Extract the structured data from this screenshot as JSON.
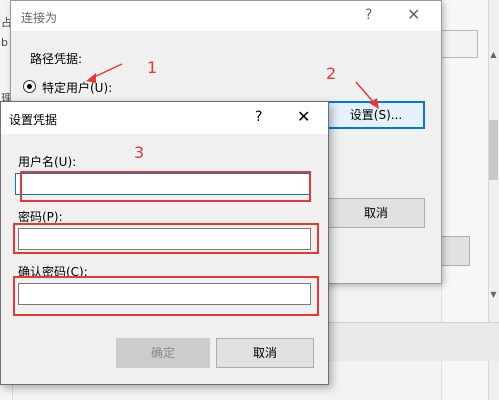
{
  "background": {
    "left_letters": [
      "占",
      "b",
      "理"
    ],
    "cancel_label": "取消"
  },
  "connect_dialog": {
    "title": "连接为",
    "help": "?",
    "close": "✕",
    "path_label": "路径凭据:",
    "radio_label": "特定用户(U):",
    "settings_label": "设置(S)...",
    "cancel_label": "取消"
  },
  "credentials_dialog": {
    "title": "设置凭据",
    "help": "?",
    "close": "✕",
    "username_label": "用户名(U):",
    "username_value": "",
    "password_label": "密码(P):",
    "password_value": "",
    "confirm_label": "确认密码(C):",
    "confirm_value": "",
    "ok_label": "确定",
    "cancel_label": "取消"
  },
  "annotations": [
    "1",
    "2",
    "3"
  ],
  "colors": {
    "annotation_red": "#e53935",
    "focus_blue": "#0078d7"
  }
}
